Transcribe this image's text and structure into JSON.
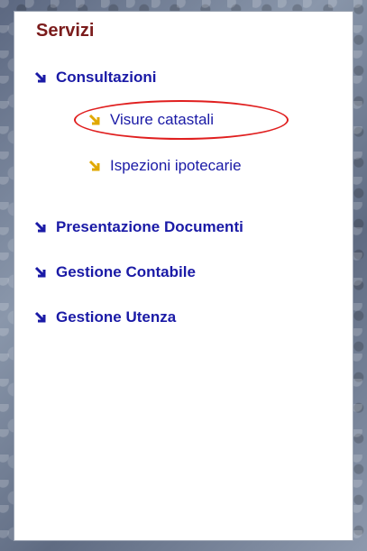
{
  "panel": {
    "title": "Servizi",
    "items": [
      {
        "label": "Consultazioni"
      },
      {
        "label": "Visure catastali"
      },
      {
        "label": "Ispezioni ipotecarie"
      },
      {
        "label": "Presentazione Documenti"
      },
      {
        "label": "Gestione Contabile"
      },
      {
        "label": "Gestione Utenza"
      }
    ]
  },
  "colors": {
    "title": "#7b1c1c",
    "link": "#1a1aa6",
    "sub_arrow": "#e0a800",
    "highlight": "#e01f1f"
  },
  "icons": {
    "main": "arrow-down-right-icon",
    "sub": "arrow-down-right-icon"
  }
}
